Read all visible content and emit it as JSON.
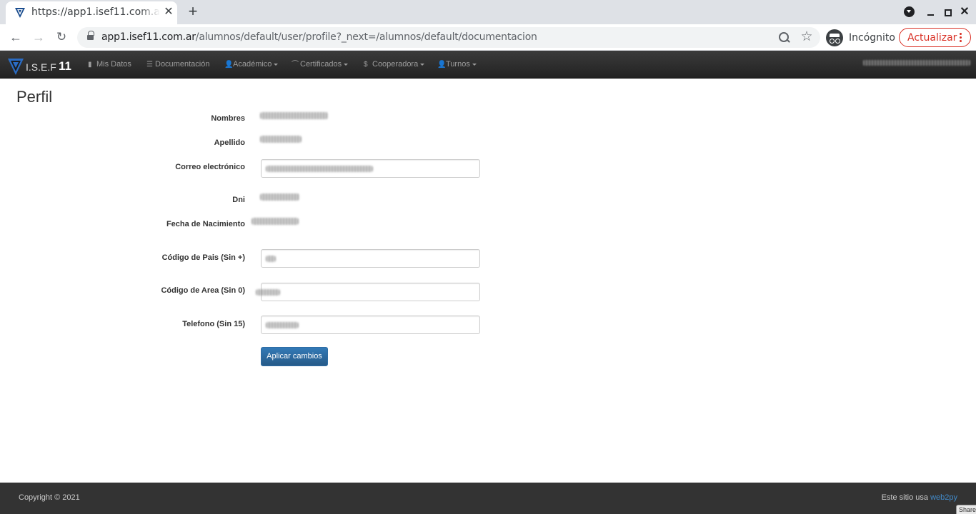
{
  "browser": {
    "tab_title": "https://app1.isef11.com.ar",
    "url_host": "app1.isef11.com.ar",
    "url_path": "/alumnos/default/user/profile?_next=/alumnos/default/documentacion",
    "incognito_label": "Incógnito",
    "update_label": "Actualizar"
  },
  "navbar": {
    "brand_name": "I.S.E.F",
    "brand_number": "11",
    "items": [
      {
        "label": "Mis Datos",
        "icon": "book-icon"
      },
      {
        "label": "Documentación",
        "icon": "list-icon"
      },
      {
        "label": "Académico",
        "icon": "user-icon",
        "dropdown": true
      },
      {
        "label": "Certificados",
        "icon": "graduation-cap-icon",
        "dropdown": true
      },
      {
        "label": "Cooperadora",
        "icon": "dollar-icon",
        "dropdown": true
      },
      {
        "label": "Turnos",
        "icon": "user-icon",
        "dropdown": true
      }
    ],
    "icon_glyphs": {
      "book": "▮",
      "list": "☰",
      "user": "👤",
      "cap": "⌒",
      "dollar": "$"
    }
  },
  "page": {
    "title": "Perfil",
    "fields": [
      {
        "label": "Nombres",
        "type": "readonly"
      },
      {
        "label": "Apellido",
        "type": "readonly"
      },
      {
        "label": "Correo electrónico",
        "type": "input"
      },
      {
        "label": "Dni",
        "type": "readonly"
      },
      {
        "label": "Fecha de Nacimiento",
        "type": "readonly"
      },
      {
        "label": "Código de Pais (Sin +)",
        "type": "input"
      },
      {
        "label": "Código de Area (Sin 0)",
        "type": "input"
      },
      {
        "label": "Telefono (Sin 15)",
        "type": "input"
      }
    ],
    "submit_label": "Aplicar cambios"
  },
  "footer": {
    "copyright": "Copyright © 2021",
    "powered_prefix": "Este sitio usa",
    "powered_link": "web2py",
    "share_label": "Share"
  },
  "colors": {
    "navbar_bg": "#222222",
    "button_primary": "#337ab7",
    "footer_bg": "#333333",
    "link": "#428bca",
    "update_red": "#d93025"
  }
}
